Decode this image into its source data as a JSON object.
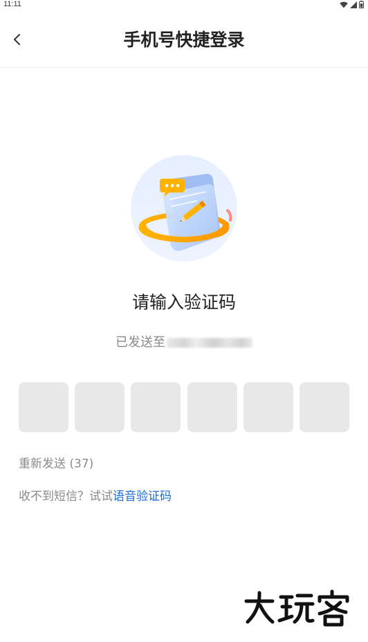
{
  "status_bar": {
    "time": "11:11"
  },
  "header": {
    "title": "手机号快捷登录"
  },
  "main": {
    "headline": "请输入验证码",
    "sent_prefix": "已发送至",
    "code_slots": [
      "",
      "",
      "",
      "",
      "",
      ""
    ],
    "resend_label": "重新发送 (37)",
    "help_text": "收不到短信？试试",
    "voice_link": "语音验证码"
  },
  "watermark": {
    "text": "大玩客"
  },
  "icons": {
    "back": "chevron-left-icon",
    "wifi": "wifi-icon",
    "signal": "signal-icon",
    "battery": "battery-icon"
  },
  "colors": {
    "link": "#1a6dd8",
    "code_box": "#e8e8e8",
    "muted_text": "#8a8a8a",
    "title_text": "#222222"
  }
}
